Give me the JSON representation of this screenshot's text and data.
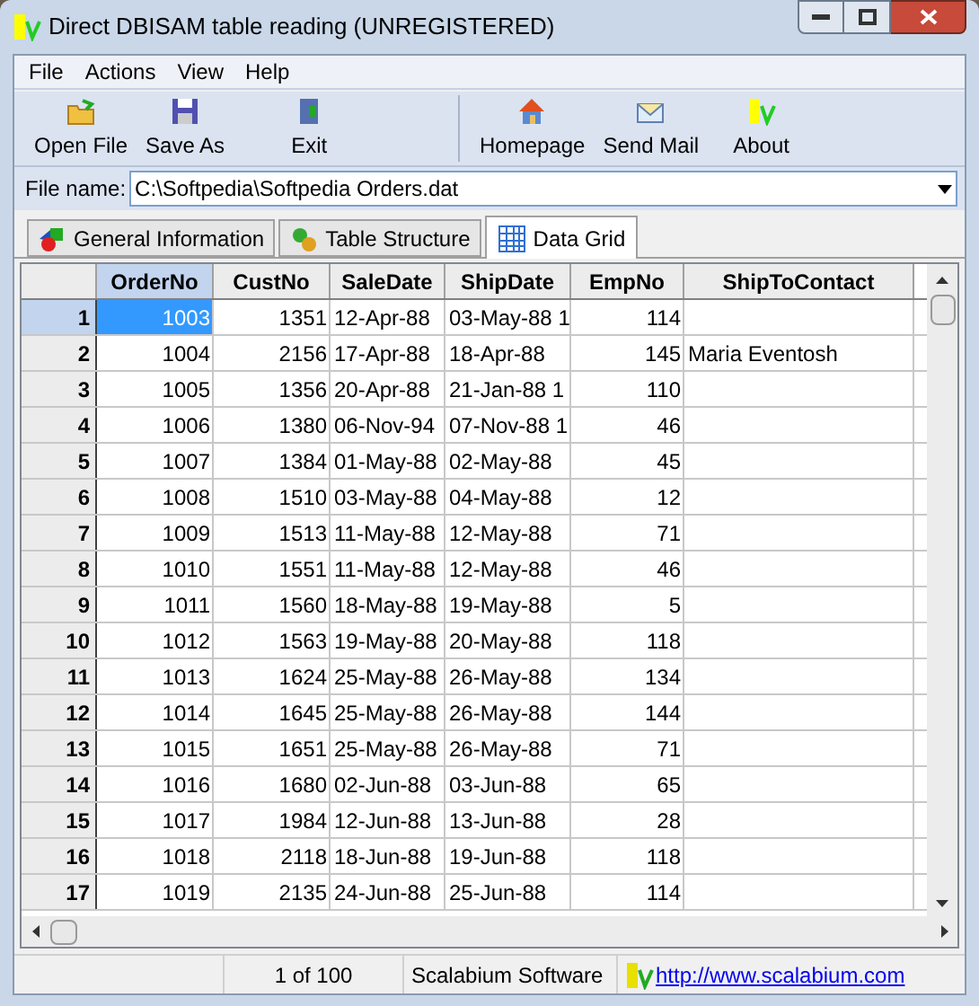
{
  "window": {
    "title": "Direct DBISAM table reading (UNREGISTERED)"
  },
  "menu": [
    "File",
    "Actions",
    "View",
    "Help"
  ],
  "toolbar": [
    {
      "label": "Open File",
      "kind": "open"
    },
    {
      "label": "Save As",
      "kind": "save"
    },
    {
      "label": "Exit",
      "kind": "exit"
    },
    {
      "label": "Homepage",
      "kind": "home"
    },
    {
      "label": "Send Mail",
      "kind": "mail"
    },
    {
      "label": "About",
      "kind": "about"
    }
  ],
  "file_name": {
    "label": "File name:",
    "value": "C:\\Softpedia\\Softpedia Orders.dat"
  },
  "tabs": [
    {
      "label": "General Information",
      "kind": "info",
      "selected": false
    },
    {
      "label": "Table Structure",
      "kind": "structure",
      "selected": false
    },
    {
      "label": "Data Grid",
      "kind": "grid",
      "selected": true
    }
  ],
  "table": {
    "columns": [
      {
        "label": "OrderNo",
        "kind": "number",
        "selected": true
      },
      {
        "label": "CustNo",
        "kind": "number",
        "selected": false
      },
      {
        "label": "SaleDate",
        "kind": "text",
        "selected": false
      },
      {
        "label": "ShipDate",
        "kind": "text",
        "selected": false
      },
      {
        "label": "EmpNo",
        "kind": "number",
        "selected": false
      },
      {
        "label": "ShipToContact",
        "kind": "text",
        "selected": false
      }
    ],
    "rows": [
      {
        "number": "1",
        "selected": true,
        "cells": [
          "1003",
          "1351",
          "12-Apr-88",
          "03-May-88 1",
          "114",
          ""
        ]
      },
      {
        "number": "2",
        "selected": false,
        "cells": [
          "1004",
          "2156",
          "17-Apr-88",
          "18-Apr-88",
          "145",
          "Maria Eventosh"
        ]
      },
      {
        "number": "3",
        "selected": false,
        "cells": [
          "1005",
          "1356",
          "20-Apr-88",
          "21-Jan-88 1",
          "110",
          ""
        ]
      },
      {
        "number": "4",
        "selected": false,
        "cells": [
          "1006",
          "1380",
          "06-Nov-94",
          "07-Nov-88 1",
          "46",
          ""
        ]
      },
      {
        "number": "5",
        "selected": false,
        "cells": [
          "1007",
          "1384",
          "01-May-88",
          "02-May-88",
          "45",
          ""
        ]
      },
      {
        "number": "6",
        "selected": false,
        "cells": [
          "1008",
          "1510",
          "03-May-88",
          "04-May-88",
          "12",
          ""
        ]
      },
      {
        "number": "7",
        "selected": false,
        "cells": [
          "1009",
          "1513",
          "11-May-88",
          "12-May-88",
          "71",
          ""
        ]
      },
      {
        "number": "8",
        "selected": false,
        "cells": [
          "1010",
          "1551",
          "11-May-88",
          "12-May-88",
          "46",
          ""
        ]
      },
      {
        "number": "9",
        "selected": false,
        "cells": [
          "1011",
          "1560",
          "18-May-88",
          "19-May-88",
          "5",
          ""
        ]
      },
      {
        "number": "10",
        "selected": false,
        "cells": [
          "1012",
          "1563",
          "19-May-88",
          "20-May-88",
          "118",
          ""
        ]
      },
      {
        "number": "11",
        "selected": false,
        "cells": [
          "1013",
          "1624",
          "25-May-88",
          "26-May-88",
          "134",
          ""
        ]
      },
      {
        "number": "12",
        "selected": false,
        "cells": [
          "1014",
          "1645",
          "25-May-88",
          "26-May-88",
          "144",
          ""
        ]
      },
      {
        "number": "13",
        "selected": false,
        "cells": [
          "1015",
          "1651",
          "25-May-88",
          "26-May-88",
          "71",
          ""
        ]
      },
      {
        "number": "14",
        "selected": false,
        "cells": [
          "1016",
          "1680",
          "02-Jun-88",
          "03-Jun-88",
          "65",
          ""
        ]
      },
      {
        "number": "15",
        "selected": false,
        "cells": [
          "1017",
          "1984",
          "12-Jun-88",
          "13-Jun-88",
          "28",
          ""
        ]
      },
      {
        "number": "16",
        "selected": false,
        "cells": [
          "1018",
          "2118",
          "18-Jun-88",
          "19-Jun-88",
          "118",
          ""
        ]
      },
      {
        "number": "17",
        "selected": false,
        "cells": [
          "1019",
          "2135",
          "24-Jun-88",
          "25-Jun-88",
          "114",
          ""
        ]
      }
    ]
  },
  "status_bar": {
    "record": "1 of 100",
    "company": "Scalabium Software",
    "link": "http://www.scalabium.com"
  }
}
